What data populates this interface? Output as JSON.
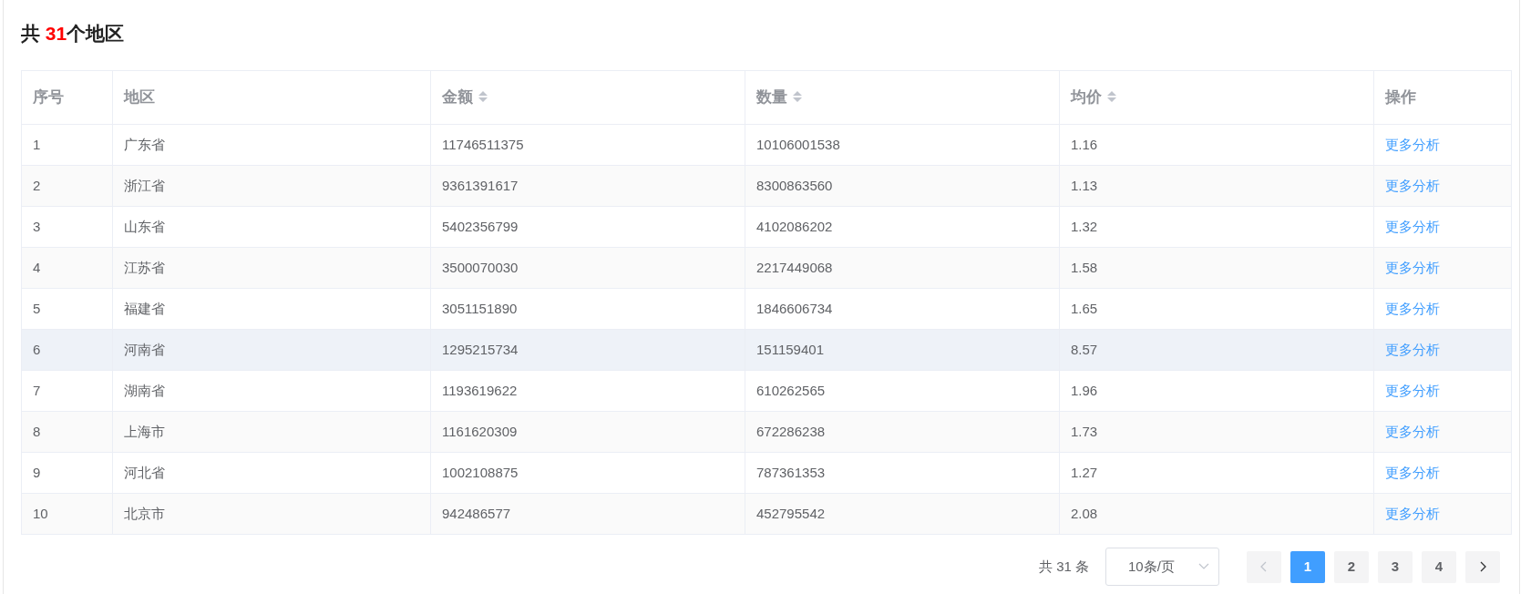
{
  "title": {
    "prefix": "共 ",
    "count": "31",
    "suffix": "个地区"
  },
  "table": {
    "columns": [
      {
        "label": "序号",
        "sortable": false
      },
      {
        "label": "地区",
        "sortable": false
      },
      {
        "label": "金额",
        "sortable": true
      },
      {
        "label": "数量",
        "sortable": true
      },
      {
        "label": "均价",
        "sortable": true
      },
      {
        "label": "操作",
        "sortable": false
      }
    ],
    "rows": [
      {
        "cells": [
          "1",
          "广东省",
          "11746511375",
          "10106001538",
          "1.16"
        ],
        "action": "更多分析",
        "highlighted": false
      },
      {
        "cells": [
          "2",
          "浙江省",
          "9361391617",
          "8300863560",
          "1.13"
        ],
        "action": "更多分析",
        "highlighted": false
      },
      {
        "cells": [
          "3",
          "山东省",
          "5402356799",
          "4102086202",
          "1.32"
        ],
        "action": "更多分析",
        "highlighted": false
      },
      {
        "cells": [
          "4",
          "江苏省",
          "3500070030",
          "2217449068",
          "1.58"
        ],
        "action": "更多分析",
        "highlighted": false
      },
      {
        "cells": [
          "5",
          "福建省",
          "3051151890",
          "1846606734",
          "1.65"
        ],
        "action": "更多分析",
        "highlighted": false
      },
      {
        "cells": [
          "6",
          "河南省",
          "1295215734",
          "151159401",
          "8.57"
        ],
        "action": "更多分析",
        "highlighted": true
      },
      {
        "cells": [
          "7",
          "湖南省",
          "1193619622",
          "610262565",
          "1.96"
        ],
        "action": "更多分析",
        "highlighted": false
      },
      {
        "cells": [
          "8",
          "上海市",
          "1161620309",
          "672286238",
          "1.73"
        ],
        "action": "更多分析",
        "highlighted": false
      },
      {
        "cells": [
          "9",
          "河北省",
          "1002108875",
          "787361353",
          "1.27"
        ],
        "action": "更多分析",
        "highlighted": false
      },
      {
        "cells": [
          "10",
          "北京市",
          "942486577",
          "452795542",
          "2.08"
        ],
        "action": "更多分析",
        "highlighted": false
      }
    ]
  },
  "pagination": {
    "total": "共 31 条",
    "page_size": "10条/页",
    "pages": [
      {
        "label": "1",
        "selected": true
      },
      {
        "label": "2",
        "selected": false
      },
      {
        "label": "3",
        "selected": false
      },
      {
        "label": "4",
        "selected": false
      }
    ]
  }
}
